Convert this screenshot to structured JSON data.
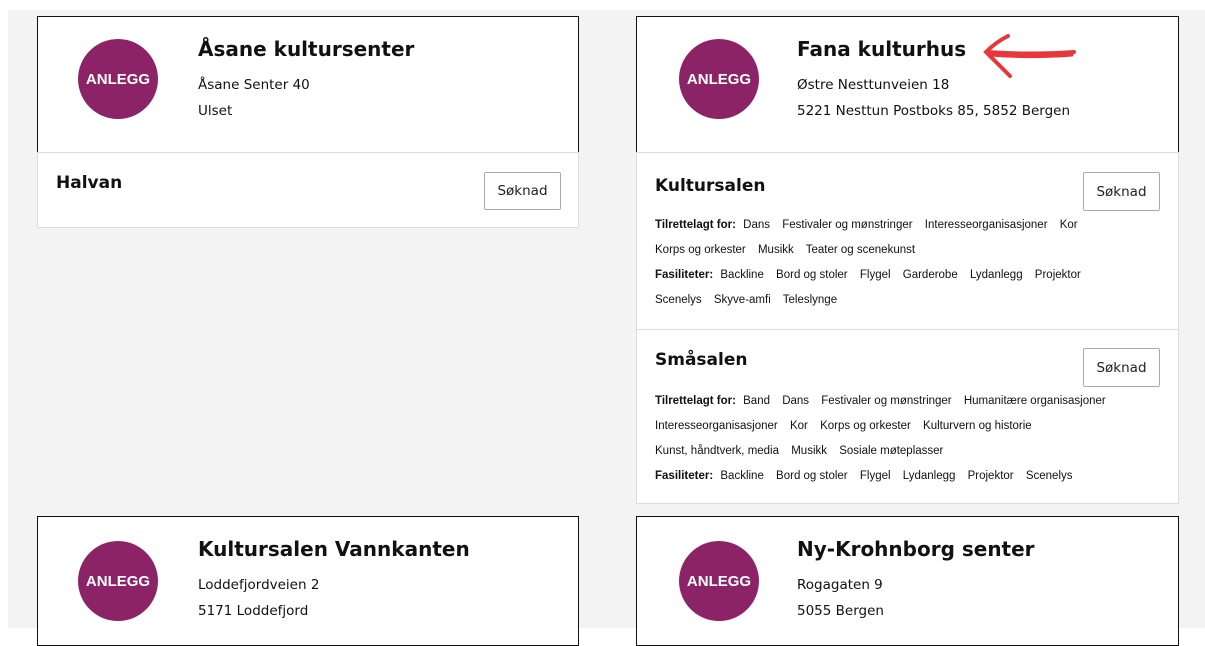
{
  "badge_label": "ANLEGG",
  "colors": {
    "badge": "#8c2367",
    "arrow": "#e8373b"
  },
  "cards": [
    {
      "name": "Åsane kultursenter",
      "address1": "Åsane Senter 40",
      "address2": "Ulset"
    },
    {
      "name": "Fana kulturhus",
      "address1": "Østre Nesttunveien 18",
      "address2": "5221 Nesttun Postboks 85, 5852 Bergen"
    },
    {
      "name": "Kultursalen Vannkanten",
      "address1": "Loddefjordveien 2",
      "address2": "5171 Loddefjord"
    },
    {
      "name": "Ny-Krohnborg senter",
      "address1": "Rogagaten 9",
      "address2": "5055 Bergen"
    }
  ],
  "halvan": {
    "title": "Halvan",
    "button": "Søknad"
  },
  "kultursalen": {
    "title": "Kultursalen",
    "button": "Søknad",
    "tilrettelagt_label": "Tilrettelagt for:",
    "tilrettelagt_line1": [
      "Dans",
      "Festivaler og mønstringer",
      "Interesseorganisasjoner",
      "Kor"
    ],
    "tilrettelagt_line2": [
      "Korps og orkester",
      "Musikk",
      "Teater og scenekunst"
    ],
    "fasiliteter_label": "Fasiliteter:",
    "fasiliteter_line1": [
      "Backline",
      "Bord og stoler",
      "Flygel",
      "Garderobe",
      "Lydanlegg",
      "Projektor"
    ],
    "fasiliteter_line2": [
      "Scenelys",
      "Skyve-amfi",
      "Teleslynge"
    ]
  },
  "smasalen": {
    "title": "Småsalen",
    "button": "Søknad",
    "tilrettelagt_label": "Tilrettelagt for:",
    "tilrettelagt_line1": [
      "Band",
      "Dans",
      "Festivaler og mønstringer",
      "Humanitære organisasjoner"
    ],
    "tilrettelagt_line2": [
      "Interesseorganisasjoner",
      "Kor",
      "Korps og orkester",
      "Kulturvern og historie"
    ],
    "tilrettelagt_line3": [
      "Kunst, håndtverk, media",
      "Musikk",
      "Sosiale møteplasser"
    ],
    "fasiliteter_label": "Fasiliteter:",
    "fasiliteter_line1": [
      "Backline",
      "Bord og stoler",
      "Flygel",
      "Lydanlegg",
      "Projektor",
      "Scenelys"
    ]
  }
}
